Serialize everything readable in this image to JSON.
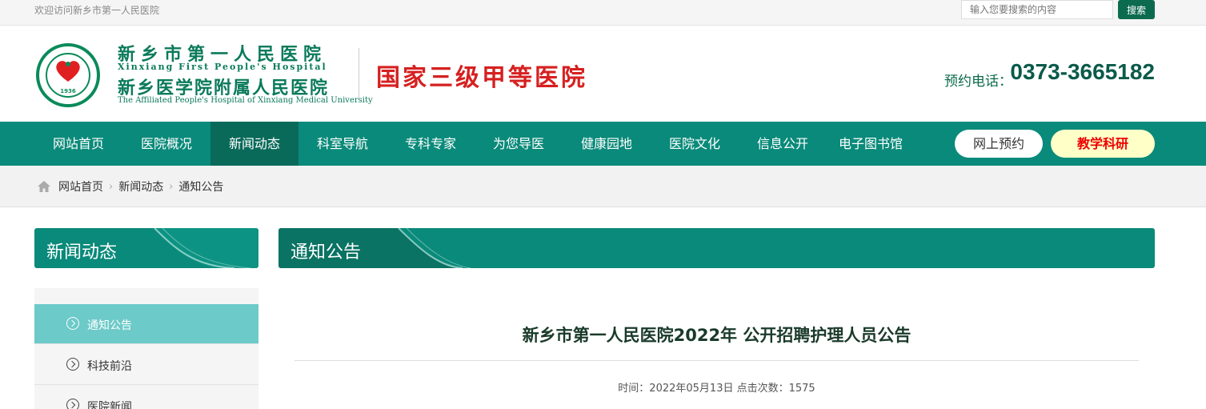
{
  "topbar": {
    "welcome": "欢迎访问新乡市第一人民医院",
    "search_placeholder": "输入您要搜索的内容",
    "search_button": "搜索"
  },
  "header": {
    "logo_year": "1936",
    "name_cn": "新乡市第一人民医院",
    "name_en": "Xinxiang First People's Hospital",
    "affiliate_cn": "新乡医学院附属人民医院",
    "affiliate_en": "The Affiliated People's Hospital of Xinxiang Medical University",
    "grade": "国家三级甲等医院",
    "phone_label": "预约电话：",
    "phone_number": "0373-3665182"
  },
  "nav": {
    "items": [
      "网站首页",
      "医院概况",
      "新闻动态",
      "科室导航",
      "专科专家",
      "为您导医",
      "健康园地",
      "医院文化",
      "信息公开",
      "电子图书馆"
    ],
    "active_index": 2,
    "appointment_button": "网上预约",
    "teaching_button": "教学科研"
  },
  "breadcrumb": {
    "items": [
      "网站首页",
      "新闻动态",
      "通知公告"
    ]
  },
  "sidebar": {
    "title": "新闻动态",
    "items": [
      "通知公告",
      "科技前沿",
      "医院新闻"
    ],
    "active_index": 0
  },
  "main": {
    "section_title": "通知公告",
    "article_title": "新乡市第一人民医院2022年 公开招聘护理人员公告",
    "meta": "时间：2022年05月13日 点击次数：1575"
  },
  "colors": {
    "primary_green": "#0a8a7a",
    "dark_green": "#0a6a5a",
    "active_side": "#6ccac8",
    "grade_red": "#d62020"
  }
}
